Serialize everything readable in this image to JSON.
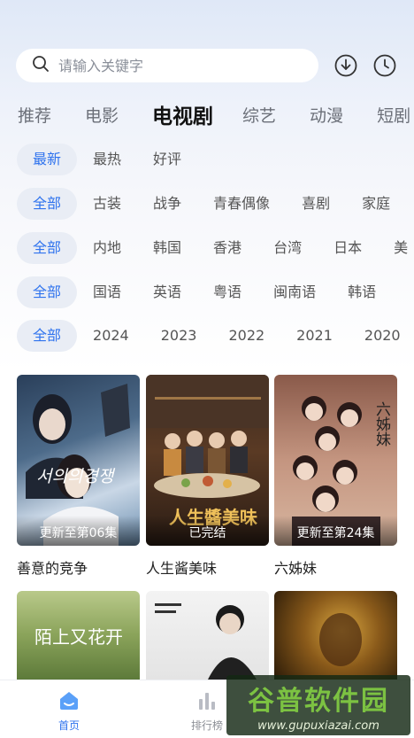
{
  "search": {
    "placeholder": "请输入关键字"
  },
  "category_tabs": [
    {
      "label": "推荐",
      "active": false
    },
    {
      "label": "电影",
      "active": false
    },
    {
      "label": "电视剧",
      "active": true
    },
    {
      "label": "综艺",
      "active": false
    },
    {
      "label": "动漫",
      "active": false
    },
    {
      "label": "短剧",
      "active": false
    }
  ],
  "filters": {
    "sort": [
      "最新",
      "最热",
      "好评"
    ],
    "genre": [
      "全部",
      "古装",
      "战争",
      "青春偶像",
      "喜剧",
      "家庭"
    ],
    "region": [
      "全部",
      "内地",
      "韩国",
      "香港",
      "台湾",
      "日本",
      "美"
    ],
    "language": [
      "全部",
      "国语",
      "英语",
      "粤语",
      "闽南语",
      "韩语"
    ],
    "year": [
      "全部",
      "2024",
      "2023",
      "2022",
      "2021",
      "2020"
    ]
  },
  "cards": [
    {
      "title": "善意的竞争",
      "badge": "更新至第06集",
      "poster_text": "서의의경쟁"
    },
    {
      "title": "人生酱美味",
      "badge": "已完结",
      "poster_text": "人生醬美味"
    },
    {
      "title": "六姊妹",
      "badge": "更新至第24集",
      "poster_text": "六姊妹"
    },
    {
      "title": "",
      "badge": "",
      "poster_text": "陌上又花开"
    },
    {
      "title": "",
      "badge": "",
      "poster_text": ""
    },
    {
      "title": "",
      "badge": "",
      "poster_text": ""
    }
  ],
  "tabbar": [
    {
      "label": "首页",
      "icon": "home-icon",
      "active": true
    },
    {
      "label": "排行榜",
      "icon": "chart-icon",
      "active": false
    }
  ],
  "watermark": {
    "main": "谷普软件园",
    "url": "www.gupuxiazai.com"
  },
  "colors": {
    "accent": "#2f73ee",
    "chip_bg": "#e9edf5"
  }
}
